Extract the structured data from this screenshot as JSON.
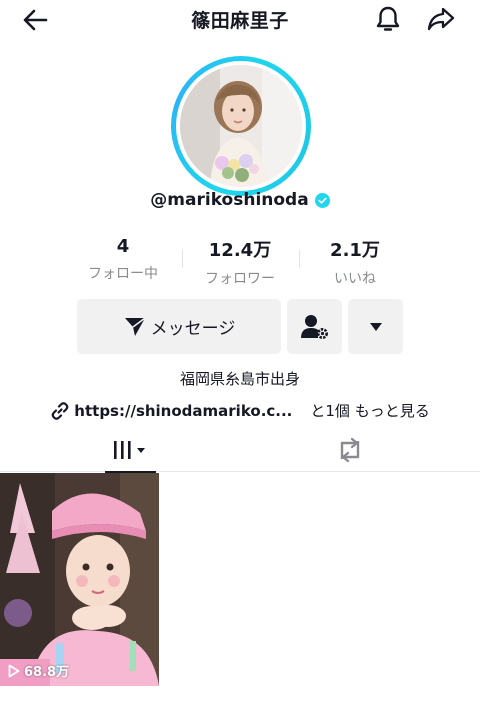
{
  "header": {
    "title": "篠田麻里子"
  },
  "profile": {
    "handle": "@marikoshinoda",
    "verified": true
  },
  "stats": [
    {
      "value": "4",
      "label": "フォロー中"
    },
    {
      "value": "12.4万",
      "label": "フォロワー"
    },
    {
      "value": "2.1万",
      "label": "いいね"
    }
  ],
  "actions": {
    "message_label": "メッセージ"
  },
  "bio": {
    "text": "福岡県糸島市出身",
    "link": "https://shinodamariko.c...",
    "link_more": "と1個 もっと見る"
  },
  "videos": [
    {
      "views": "68.8万"
    }
  ],
  "colors": {
    "accent_ring": "#20d5ec",
    "verified": "#20d5ec",
    "button_bg": "#f1f1f2"
  }
}
